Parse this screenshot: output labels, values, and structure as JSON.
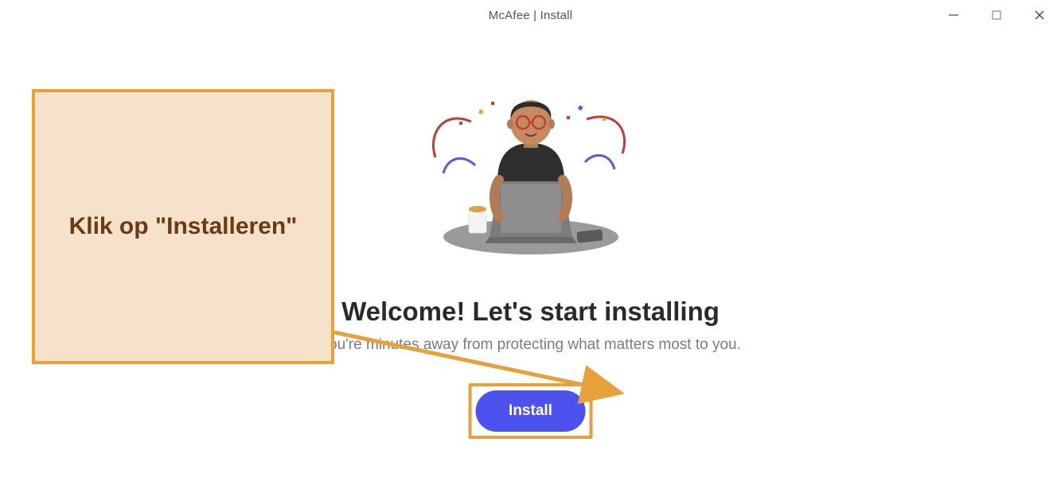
{
  "window": {
    "title": "McAfee | Install"
  },
  "main": {
    "heading": "Welcome! Let's start installing",
    "subheading": "You're minutes away from protecting what matters most to you.",
    "install_label": "Install"
  },
  "callout": {
    "text": "Klik op \"Installeren\""
  },
  "colors": {
    "accent_orange": "#e6a13a",
    "callout_bg": "#f6e2cb",
    "callout_text": "#6a3a12",
    "button_bg": "#4d52ef"
  }
}
